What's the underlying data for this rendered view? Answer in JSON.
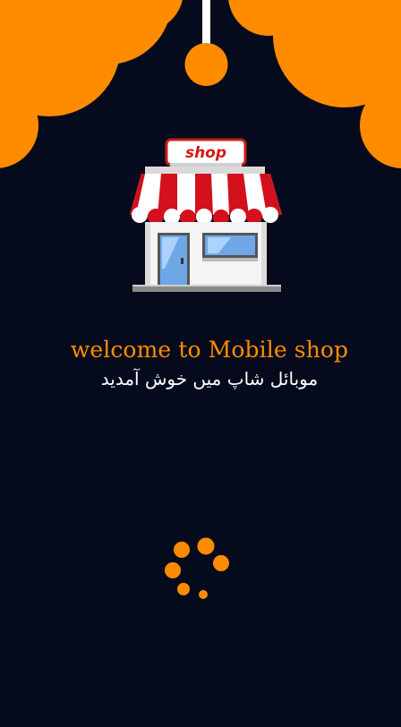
{
  "app": {
    "name": "Mobile shop"
  },
  "splash": {
    "shop_sign_text": "shop",
    "welcome_english": "welcome to Mobile shop",
    "welcome_urdu": "موبائل شاپ میں خوش آمدید"
  },
  "theme": {
    "background": "#050b1c",
    "accent": "#ff8c00",
    "text_primary": "#ffffff"
  },
  "icons": {
    "store": "shop-store-icon",
    "loading": "loading-spinner-icon"
  }
}
